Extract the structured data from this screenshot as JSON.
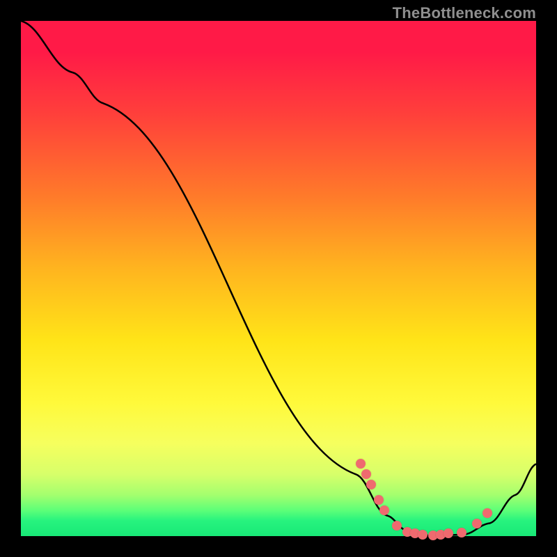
{
  "attribution": "TheBottleneck.com",
  "chart_data": {
    "type": "line",
    "title": "",
    "xlabel": "",
    "ylabel": "",
    "xlim": [
      0,
      100
    ],
    "ylim": [
      0,
      100
    ],
    "curve": [
      {
        "x": 0,
        "y": 100
      },
      {
        "x": 10,
        "y": 90
      },
      {
        "x": 16,
        "y": 84
      },
      {
        "x": 65,
        "y": 12
      },
      {
        "x": 71,
        "y": 4
      },
      {
        "x": 75,
        "y": 1
      },
      {
        "x": 80,
        "y": 0
      },
      {
        "x": 86,
        "y": 0.3
      },
      {
        "x": 91,
        "y": 2.5
      },
      {
        "x": 96,
        "y": 8
      },
      {
        "x": 100,
        "y": 14
      }
    ],
    "markers": [
      {
        "x": 66,
        "y": 14
      },
      {
        "x": 67,
        "y": 12
      },
      {
        "x": 68,
        "y": 10
      },
      {
        "x": 69.5,
        "y": 7
      },
      {
        "x": 70.5,
        "y": 5
      },
      {
        "x": 73,
        "y": 2
      },
      {
        "x": 75,
        "y": 0.8
      },
      {
        "x": 76.5,
        "y": 0.5
      },
      {
        "x": 78,
        "y": 0.3
      },
      {
        "x": 80,
        "y": 0.2
      },
      {
        "x": 81.5,
        "y": 0.3
      },
      {
        "x": 83,
        "y": 0.5
      },
      {
        "x": 85.5,
        "y": 0.7
      },
      {
        "x": 88.5,
        "y": 2.5
      },
      {
        "x": 90.5,
        "y": 4.5
      }
    ],
    "colors": {
      "curve": "#000000",
      "marker": "#ef6a6f",
      "gradient_top": "#ff1a47",
      "gradient_mid": "#fff93a",
      "gradient_bottom": "#18e977"
    }
  }
}
